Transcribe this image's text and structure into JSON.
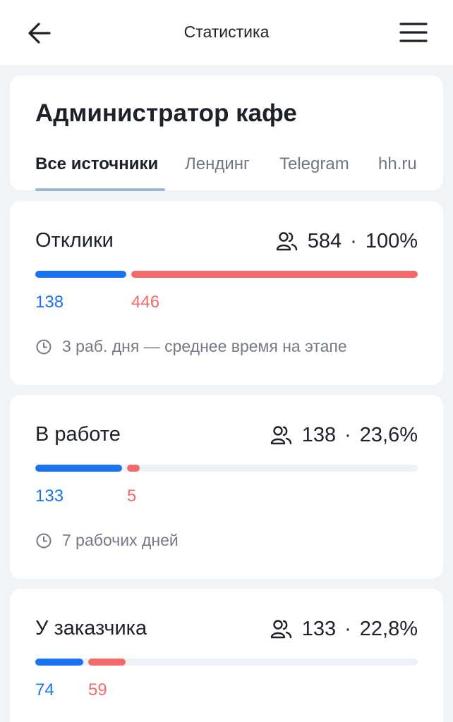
{
  "header": {
    "title": "Статистика",
    "back_icon": "arrow-left-icon",
    "menu_icon": "hamburger-menu-icon"
  },
  "job": {
    "title": "Администратор кафе",
    "tabs": [
      {
        "label": "Все источники",
        "active": true
      },
      {
        "label": "Лендинг",
        "active": false
      },
      {
        "label": "Telegram",
        "active": false
      },
      {
        "label": "hh.ru",
        "active": false
      }
    ]
  },
  "stages": [
    {
      "title": "Отклики",
      "count": "584",
      "percent": "100%",
      "blue_value": "138",
      "red_value": "446",
      "time_text": "3 раб. дня — среднее время на этапе"
    },
    {
      "title": "В работе",
      "count": "138",
      "percent": "23,6%",
      "blue_value": "133",
      "red_value": "5",
      "time_text": "7 рабочих дней"
    },
    {
      "title": "У заказчика",
      "count": "133",
      "percent": "22,8%",
      "blue_value": "74",
      "red_value": "59"
    }
  ],
  "colors": {
    "accent_blue": "#1a73f0",
    "accent_red": "#f46a6a",
    "background": "#f0f3f7",
    "track": "#eef1f5"
  }
}
